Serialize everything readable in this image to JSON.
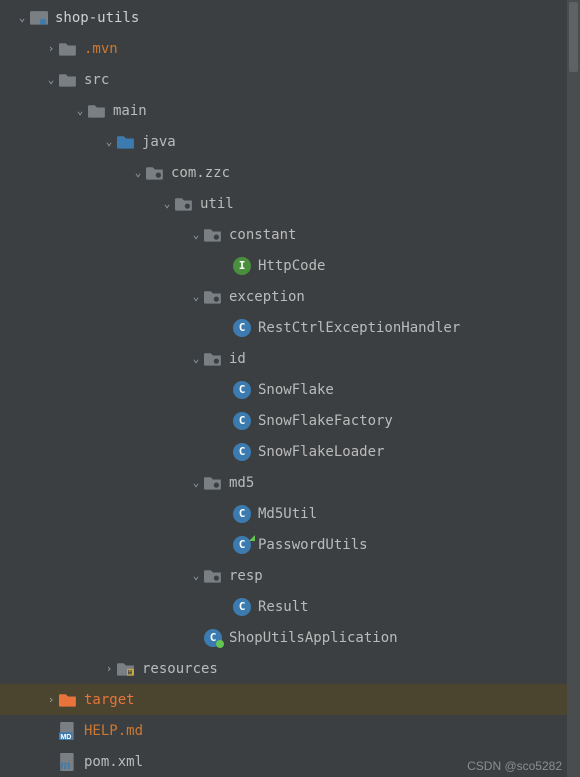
{
  "watermark_text": "CSDN @sco5282",
  "tree": [
    {
      "depth": 0,
      "chev": "down",
      "icon": "module",
      "color": "root",
      "label": "shop-utils"
    },
    {
      "depth": 1,
      "chev": "right",
      "icon": "folder",
      "fcolor": "#7a7f83",
      "color": "dim",
      "label": ".mvn"
    },
    {
      "depth": 1,
      "chev": "down",
      "icon": "folder",
      "fcolor": "#7a7f83",
      "color": "",
      "label": "src"
    },
    {
      "depth": 2,
      "chev": "down",
      "icon": "folder",
      "fcolor": "#7a7f83",
      "color": "",
      "label": "main"
    },
    {
      "depth": 3,
      "chev": "down",
      "icon": "folder",
      "fcolor": "#3c7bb0",
      "color": "",
      "label": "java"
    },
    {
      "depth": 4,
      "chev": "down",
      "icon": "package",
      "fcolor": "#7a7f83",
      "color": "",
      "label": "com.zzc"
    },
    {
      "depth": 5,
      "chev": "down",
      "icon": "package",
      "fcolor": "#7a7f83",
      "color": "",
      "label": "util"
    },
    {
      "depth": 6,
      "chev": "down",
      "icon": "package",
      "fcolor": "#7a7f83",
      "color": "",
      "label": "constant"
    },
    {
      "depth": 7,
      "chev": "",
      "icon": "interface",
      "color": "",
      "label": "HttpCode"
    },
    {
      "depth": 6,
      "chev": "down",
      "icon": "package",
      "fcolor": "#7a7f83",
      "color": "",
      "label": "exception"
    },
    {
      "depth": 7,
      "chev": "",
      "icon": "class",
      "color": "",
      "label": "RestCtrlExceptionHandler"
    },
    {
      "depth": 6,
      "chev": "down",
      "icon": "package",
      "fcolor": "#7a7f83",
      "color": "",
      "label": "id"
    },
    {
      "depth": 7,
      "chev": "",
      "icon": "class",
      "color": "",
      "label": "SnowFlake"
    },
    {
      "depth": 7,
      "chev": "",
      "icon": "class",
      "color": "",
      "label": "SnowFlakeFactory"
    },
    {
      "depth": 7,
      "chev": "",
      "icon": "class",
      "color": "",
      "label": "SnowFlakeLoader"
    },
    {
      "depth": 6,
      "chev": "down",
      "icon": "package",
      "fcolor": "#7a7f83",
      "color": "",
      "label": "md5"
    },
    {
      "depth": 7,
      "chev": "",
      "icon": "class",
      "color": "",
      "label": "Md5Util"
    },
    {
      "depth": 7,
      "chev": "",
      "icon": "class",
      "color": "",
      "runnable": true,
      "label": "PasswordUtils"
    },
    {
      "depth": 6,
      "chev": "down",
      "icon": "package",
      "fcolor": "#7a7f83",
      "color": "",
      "label": "resp"
    },
    {
      "depth": 7,
      "chev": "",
      "icon": "class",
      "color": "",
      "label": "Result"
    },
    {
      "depth": 6,
      "chev": "",
      "icon": "springboot",
      "color": "",
      "label": "ShopUtilsApplication"
    },
    {
      "depth": 3,
      "chev": "right",
      "icon": "resources",
      "fcolor": "#7a7f83",
      "color": "",
      "label": "resources"
    },
    {
      "depth": 1,
      "chev": "right",
      "icon": "folder",
      "fcolor": "#e8743b",
      "color": "excluded",
      "label": "target",
      "selected": true
    },
    {
      "depth": 1,
      "chev": "",
      "icon": "md",
      "color": "orange",
      "label": "HELP.md"
    },
    {
      "depth": 1,
      "chev": "",
      "icon": "maven",
      "color": "",
      "label": "pom.xml"
    }
  ]
}
